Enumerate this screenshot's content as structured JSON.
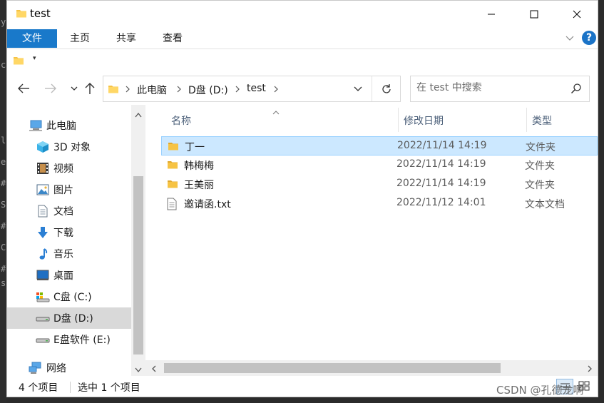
{
  "window": {
    "title": "test"
  },
  "window_controls": {
    "minimize": "minimize",
    "maximize": "maximize",
    "close": "close"
  },
  "ribbon": {
    "tabs": [
      {
        "label": "文件",
        "active": true
      },
      {
        "label": "主页"
      },
      {
        "label": "共享"
      },
      {
        "label": "查看"
      }
    ],
    "help": "?"
  },
  "quick_access": {
    "arrow": "▾"
  },
  "address": {
    "crumbs": [
      "此电脑",
      "D盘 (D:)",
      "test"
    ]
  },
  "search": {
    "placeholder": "在 test 中搜索",
    "value": ""
  },
  "nav_pane": {
    "items": [
      {
        "label": "此电脑",
        "icon": "computer-icon"
      },
      {
        "label": "3D 对象",
        "icon": "cube-3d-icon"
      },
      {
        "label": "视频",
        "icon": "video-icon"
      },
      {
        "label": "图片",
        "icon": "picture-icon"
      },
      {
        "label": "文档",
        "icon": "document-icon"
      },
      {
        "label": "下载",
        "icon": "download-icon"
      },
      {
        "label": "音乐",
        "icon": "music-icon"
      },
      {
        "label": "桌面",
        "icon": "desktop-icon"
      },
      {
        "label": "C盘 (C:)",
        "icon": "system-drive-icon"
      },
      {
        "label": "D盘 (D:)",
        "icon": "drive-icon",
        "selected": true
      },
      {
        "label": "E盘软件 (E:)",
        "icon": "drive-icon"
      },
      {
        "label": "网络",
        "icon": "network-icon"
      }
    ]
  },
  "file_list": {
    "columns": [
      "名称",
      "修改日期",
      "类型"
    ],
    "rows": [
      {
        "name": "丁一",
        "date": "2022/11/14 14:19",
        "type": "文件夹",
        "icon": "folder-icon",
        "selected": true
      },
      {
        "name": "韩梅梅",
        "date": "2022/11/14 14:19",
        "type": "文件夹",
        "icon": "folder-icon"
      },
      {
        "name": "王美丽",
        "date": "2022/11/14 14:19",
        "type": "文件夹",
        "icon": "folder-icon"
      },
      {
        "name": "邀请函.txt",
        "date": "2022/11/12 14:01",
        "type": "文本文档",
        "icon": "text-file-icon"
      }
    ]
  },
  "status": {
    "count": "4 个项目",
    "selection": "选中 1 个项目"
  },
  "watermark": "CSDN @孔德龙啊",
  "colors": {
    "accent": "#1979ca",
    "selection": "#cce8ff",
    "selection_border": "#99d1ff",
    "folder": "#f6c344"
  }
}
